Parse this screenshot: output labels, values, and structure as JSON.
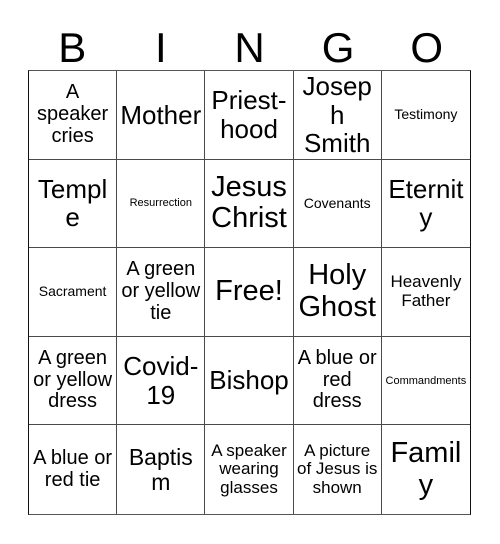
{
  "card": {
    "header_letters": [
      "B",
      "I",
      "N",
      "G",
      "O"
    ],
    "grid": {
      "columns": 5,
      "rows": 5,
      "cells": [
        {
          "text": "A speaker cries",
          "size": "md"
        },
        {
          "text": "Mother",
          "size": "xl"
        },
        {
          "text": "Priest-hood",
          "size": "xl"
        },
        {
          "text": "Joseph Smith",
          "size": "xl"
        },
        {
          "text": "Testimony",
          "size": "xs"
        },
        {
          "text": "Temple",
          "size": "xl"
        },
        {
          "text": "Resurrection",
          "size": "xxs"
        },
        {
          "text": "Jesus Christ",
          "size": "xxl"
        },
        {
          "text": "Covenants",
          "size": "xs"
        },
        {
          "text": "Eternity",
          "size": "xl"
        },
        {
          "text": "Sacrament",
          "size": "xs"
        },
        {
          "text": "A green or yellow tie",
          "size": "md"
        },
        {
          "text": "Free!",
          "size": "xxl"
        },
        {
          "text": "Holy Ghost",
          "size": "xxl"
        },
        {
          "text": "Heavenly Father",
          "size": "sm"
        },
        {
          "text": "A green or yellow dress",
          "size": "md"
        },
        {
          "text": "Covid-19",
          "size": "xl"
        },
        {
          "text": "Bishop",
          "size": "xl"
        },
        {
          "text": "A blue or red dress",
          "size": "md"
        },
        {
          "text": "Commandments",
          "size": "xxs"
        },
        {
          "text": "A blue or red tie",
          "size": "md"
        },
        {
          "text": "Baptism",
          "size": "lg"
        },
        {
          "text": "A speaker wearing glasses",
          "size": "sm"
        },
        {
          "text": "A picture of Jesus is shown",
          "size": "sm"
        },
        {
          "text": "Family",
          "size": "xxl"
        }
      ]
    }
  },
  "colors": {
    "background": "#ffffff",
    "text": "#000000",
    "grid_line": "#4a4a4a",
    "outer_border": "#111111"
  }
}
